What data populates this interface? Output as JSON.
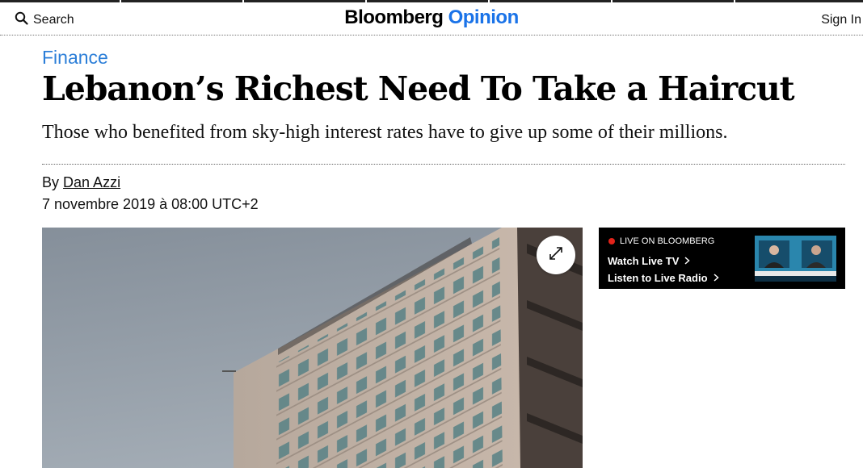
{
  "header": {
    "search_label": "Search",
    "logo_brand": "Bloomberg",
    "logo_section": "Opinion",
    "signin_label": "Sign In"
  },
  "article": {
    "category": "Finance",
    "headline": "Lebanon’s Richest Need To Take a Haircut",
    "deck": "Those who benefited from sky-high interest rates have to give up some of their millions.",
    "byline_prefix": "By",
    "author": "Dan Azzi",
    "date": "7 novembre 2019 à 08:00 UTC+2"
  },
  "live": {
    "label": "LIVE ON BLOOMBERG",
    "watch": "Watch Live TV",
    "listen": "Listen to Live Radio"
  },
  "icons": [
    "search-icon",
    "expand-icon",
    "chevron-right-icon",
    "live-dot-icon"
  ],
  "colors": {
    "opinion_blue": "#1a73e8",
    "category_blue": "#2b7ed8",
    "live_red": "#e2231a",
    "live_panel": "#000000"
  }
}
